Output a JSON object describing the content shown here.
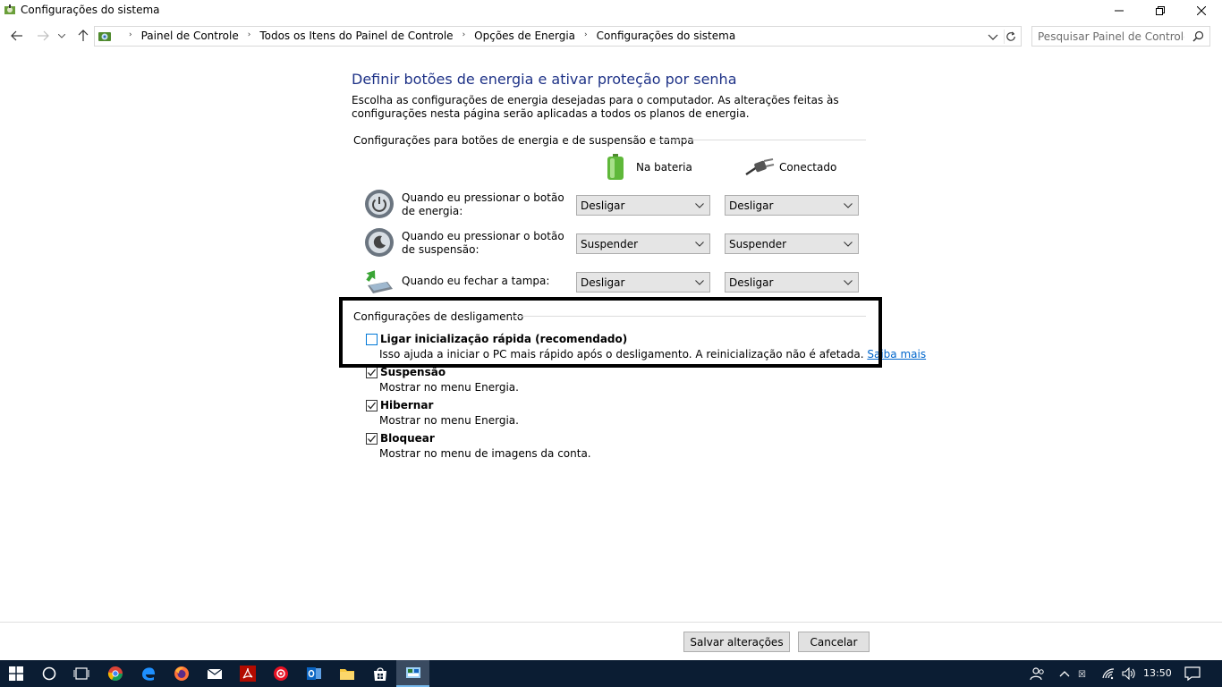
{
  "window": {
    "title": "Configurações do sistema",
    "icon": "control-panel-power-icon"
  },
  "nav": {
    "breadcrumbs": [
      "Painel de Controle",
      "Todos os Itens do Painel de Controle",
      "Opções de Energia",
      "Configurações do sistema"
    ],
    "search_placeholder": "Pesquisar Painel de Controle"
  },
  "page": {
    "heading": "Definir botões de energia e ativar proteção por senha",
    "description": "Escolha as configurações de energia desejadas para o computador. As alterações feitas às configurações nesta página serão aplicadas a todos os planos de energia.",
    "buttons_section_title": "Configurações para botões de energia e de suspensão e tampa",
    "col_battery": "Na bateria",
    "col_plugged": "Conectado",
    "rows": [
      {
        "label": "Quando eu pressionar o botão de energia:",
        "battery": "Desligar",
        "plugged": "Desligar",
        "icon": "power-button-icon"
      },
      {
        "label": "Quando eu pressionar o botão de suspensão:",
        "battery": "Suspender",
        "plugged": "Suspender",
        "icon": "sleep-button-icon"
      },
      {
        "label": "Quando eu fechar a tampa:",
        "battery": "Desligar",
        "plugged": "Desligar",
        "icon": "laptop-lid-icon"
      }
    ],
    "shutdown_section_title": "Configurações de desligamento",
    "shutdown_options": [
      {
        "title": "Ligar inicialização rápida (recomendado)",
        "desc": "Isso ajuda a iniciar o PC mais rápido após o desligamento. A reinicialização não é afetada.",
        "link": "Saiba mais",
        "checked": false
      },
      {
        "title": "Suspensão",
        "desc": "Mostrar no menu Energia.",
        "checked": true
      },
      {
        "title": "Hibernar",
        "desc": "Mostrar no menu Energia.",
        "checked": true
      },
      {
        "title": "Bloquear",
        "desc": "Mostrar no menu de imagens da conta.",
        "checked": true
      }
    ]
  },
  "footer": {
    "save_label": "Salvar alterações",
    "cancel_label": "Cancelar"
  },
  "taskbar": {
    "clock": "13:50",
    "apps": [
      "start-icon",
      "cortana-icon",
      "task-view-icon",
      "chrome-icon",
      "edge-icon",
      "firefox-icon",
      "mail-icon",
      "acrobat-icon",
      "app-red-icon",
      "outlook-icon",
      "file-explorer-icon",
      "store-icon",
      "control-panel-icon"
    ]
  },
  "colors": {
    "heading": "#1e3287",
    "link": "#0066cc",
    "taskbar": "#0b1d33"
  }
}
